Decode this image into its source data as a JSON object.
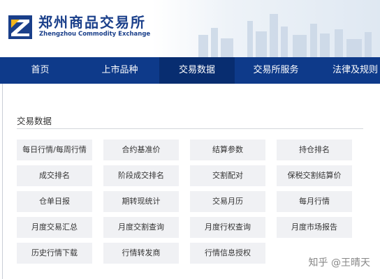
{
  "header": {
    "logo_cn": "郑州商品交易所",
    "logo_en": "Zhengzhou Commodity Exchange"
  },
  "nav": {
    "items": [
      {
        "label": "首页"
      },
      {
        "label": "上市品种"
      },
      {
        "label": "交易数据",
        "active": true
      },
      {
        "label": "交易所服务"
      },
      {
        "label": "法律及规则"
      }
    ]
  },
  "section": {
    "title": "交易数据",
    "links": [
      "每日行情/每周行情",
      "合约基准价",
      "结算参数",
      "持仓排名",
      "成交排名",
      "阶段成交排名",
      "交割配对",
      "保税交割结算价",
      "仓单日报",
      "期转现统计",
      "交易月历",
      "每月行情",
      "月度交易汇总",
      "月度交割查询",
      "月度行权查询",
      "月度市场报告",
      "历史行情下载",
      "行情转发商",
      "行情信息授权"
    ]
  },
  "watermark": "知乎 @王晴天",
  "colors": {
    "brand_blue": "#1a3f8a",
    "nav_bg": "#0e3a8a",
    "nav_active": "#082d70",
    "cell_bg": "#f0f1f4"
  }
}
